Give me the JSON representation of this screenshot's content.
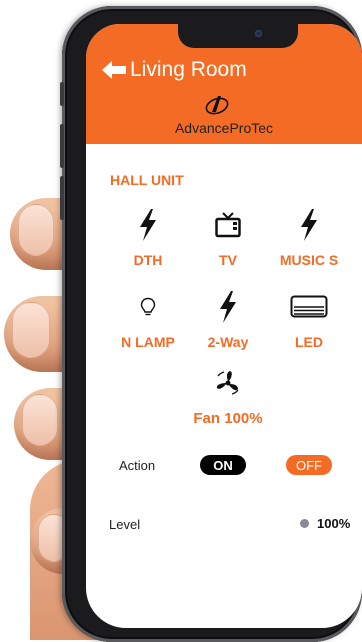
{
  "header": {
    "back_icon": "left-arrow-icon",
    "title": "Living Room",
    "brand": "AdvanceProTec",
    "accent_color": "#f36b24"
  },
  "unit": {
    "title": "HALL UNIT"
  },
  "devices": [
    {
      "label": "DTH",
      "icon": "lightning-bolt-icon"
    },
    {
      "label": "TV",
      "icon": "tv-icon"
    },
    {
      "label": "MUSIC S",
      "icon": "lightning-bolt-icon"
    },
    {
      "label": "N LAMP",
      "icon": "bulb-icon"
    },
    {
      "label": "2-Way",
      "icon": "lightning-bolt-icon"
    },
    {
      "label": "LED",
      "icon": "air-conditioner-icon"
    },
    {
      "label": "Fan 100%",
      "icon": "fan-icon"
    }
  ],
  "action": {
    "label": "Action",
    "on_label": "ON",
    "off_label": "OFF"
  },
  "level": {
    "label": "Level",
    "value": "100%"
  }
}
